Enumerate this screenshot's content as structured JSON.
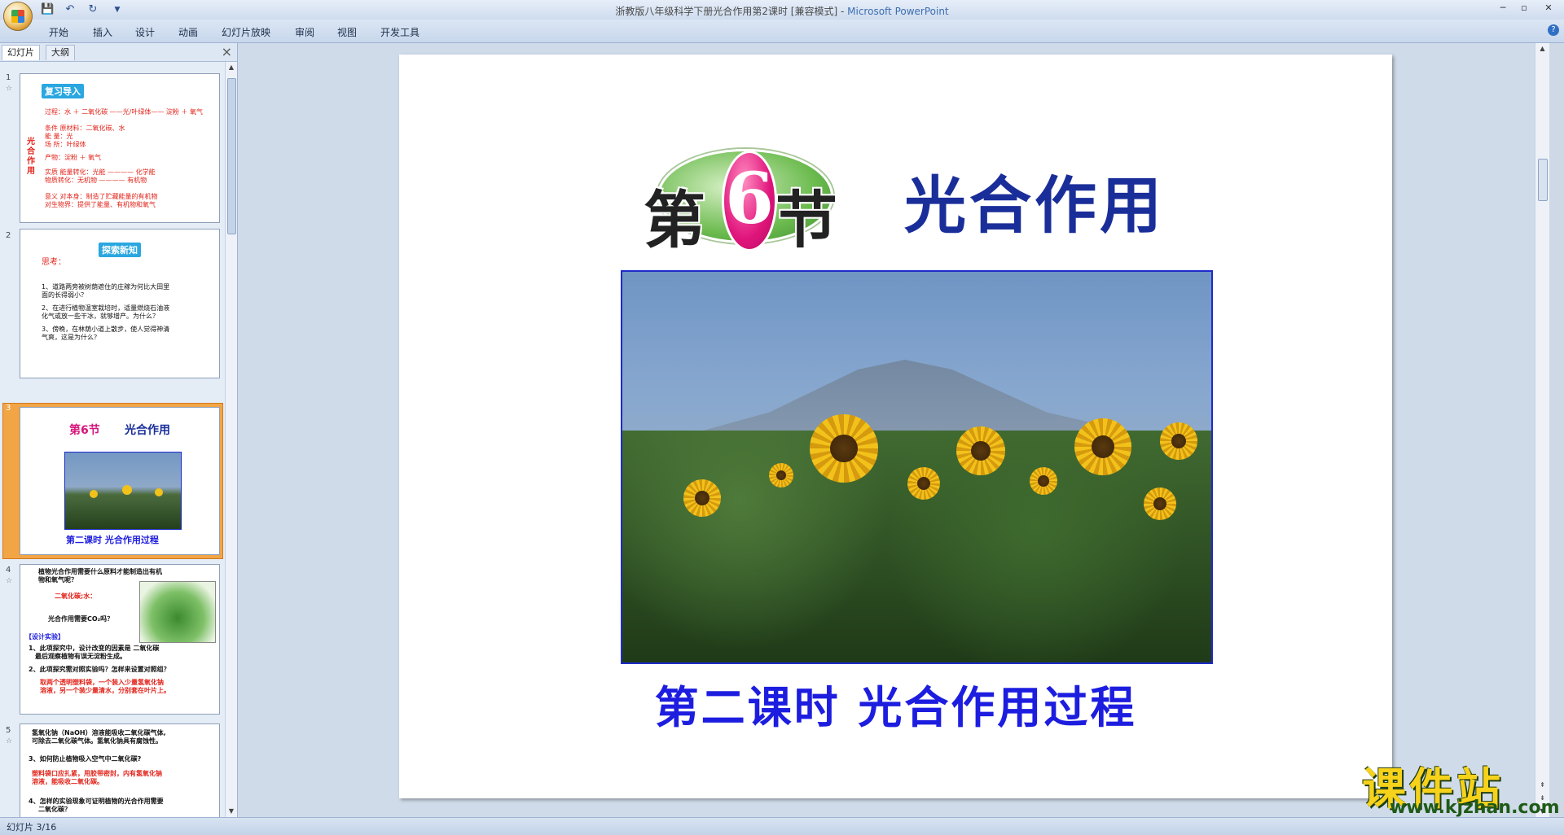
{
  "window": {
    "title_doc": "浙教版八年级科学下册光合作用第2课时 [兼容模式] - ",
    "title_app": "Microsoft PowerPoint",
    "min": "─",
    "max": "▫",
    "close": "✕"
  },
  "quick_access": {
    "save_icon": "💾",
    "undo_icon": "↶",
    "redo_icon": "↻",
    "more_icon": "▼"
  },
  "ribbon": {
    "tabs": [
      "开始",
      "插入",
      "设计",
      "动画",
      "幻灯片放映",
      "审阅",
      "视图",
      "开发工具"
    ],
    "help_icon": "?"
  },
  "panel": {
    "tab_slides": "幻灯片",
    "tab_outline": "大纲",
    "close": "×",
    "selected": 3,
    "thumbs": {
      "s1": {
        "num": "1",
        "title": "复习导入",
        "side_label": "光合作用",
        "lines": [
          "过程：水 ＋ 二氧化碳 ——光/叶绿体—— 淀粉 ＋ 氧气",
          "条件  原材料：二氧化碳、水",
          "        能  量：光",
          "        场  所：叶绿体",
          "产物：淀粉 ＋ 氧气",
          "实质  能量转化：光能 ———— 化学能",
          "        物质转化：无机物 ———— 有机物",
          "意义  对本身：制造了贮藏能量的有机物",
          "        对生物界：提供了能量、有机物和氧气"
        ]
      },
      "s2": {
        "num": "2",
        "title": "探索新知",
        "heading": "思考：",
        "lines": [
          "1、道路两旁被树荫遮住的庄稼为何比大田里",
          "    面的长得弱小？",
          "2、在进行植物温室栽培时，适量燃烧石油液",
          "    化气或放一些干冰，就够增产。为什么？",
          "3、傍晚，在林荫小道上散步，使人觉得神清",
          "    气爽，这是为什么？"
        ]
      },
      "s3": {
        "num": "3",
        "badge": "第6节",
        "title": "光合作用",
        "subtitle": "第二课时  光合作用过程"
      },
      "s4": {
        "num": "4",
        "lines": [
          "植物光合作用需要什么原料才能制造出有机",
          "物和氧气呢？",
          "二氧化碳;水：",
          "光合作用需要CO₂吗？",
          "【设计实验】",
          "1、此项探究中，设计改变的因素是 二氧化碳",
          "  最后观察植物有误无淀粉生成。",
          "2、此项探究需对照实验吗？怎样来设置对照组？",
          "取两个透明塑料袋，一个装入少量氢氧化钠",
          "溶液，另一个装少量清水，分别套在叶片上。"
        ]
      },
      "s5": {
        "num": "5",
        "lines": [
          "氢氧化钠（NaOH）溶液能吸收二氧化碳气体,",
          "可除去二氧化碳气体。氢氧化钠具有腐蚀性。",
          "3、如何防止植物吸入空气中二氧化碳?",
          "塑料袋口应扎紧，用胶带密封，内有氢氧化钠",
          "溶液，能吸收二氧化碳。",
          "4、怎样的实验现象可证明植物的光合作用需要",
          "二氧化碳？"
        ]
      }
    }
  },
  "slide": {
    "badge_left": "第",
    "badge_num": "6",
    "badge_right": "节",
    "heading": "光合作用",
    "subtitle": "第二课时   光合作用过程",
    "image_desc_icon": "sunflower-photo"
  },
  "watermark": {
    "text": "课件站",
    "url": "www.kjzhan.com"
  },
  "status": {
    "text": "幻灯片 3/16"
  },
  "colors": {
    "heading": "#1a2e9a",
    "subtitle": "#1d1de0",
    "accent_red": "#e2231a",
    "selected_thumb": "#f2a545"
  }
}
